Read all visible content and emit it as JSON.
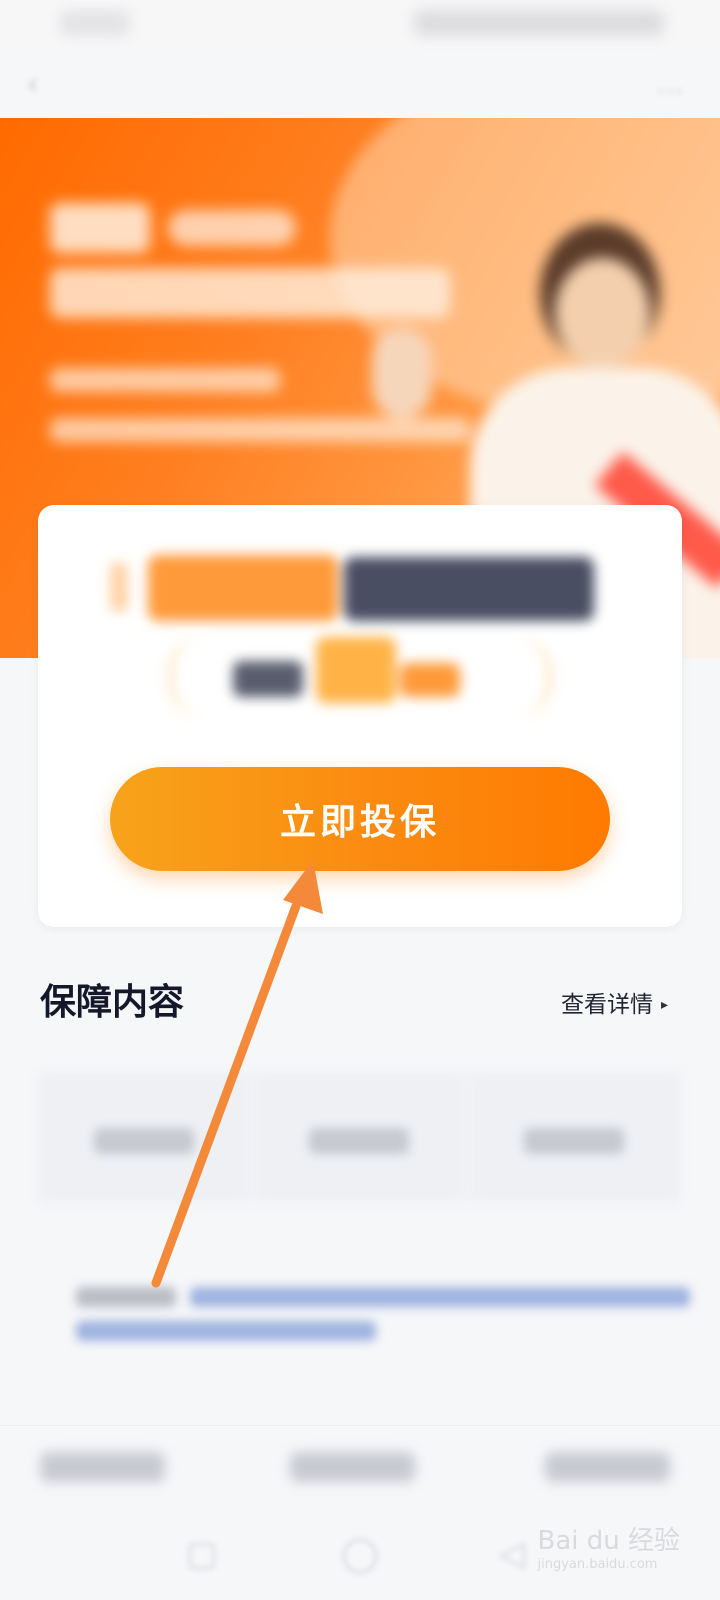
{
  "cta": {
    "label": "立即投保"
  },
  "section": {
    "title": "保障内容",
    "details_link": "查看详情"
  },
  "icons": {
    "details_arrow": "▸",
    "back": "‹",
    "more": "…",
    "home": "◯",
    "back_nav": "◁",
    "recent": "▢"
  },
  "watermark": {
    "text": "Bai du 经验",
    "sub": "jingyan.baidu.com"
  },
  "colors": {
    "accent": "#ff7a00",
    "cta_start": "#f7a31a",
    "annotation_arrow": "#f5893a"
  }
}
